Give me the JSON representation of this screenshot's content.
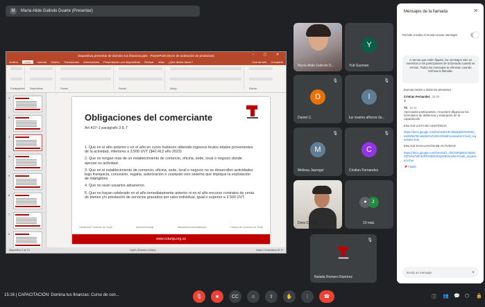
{
  "presenter_bar": {
    "initial": "M",
    "label": "María Alide Galindo Duarte (Presentar)"
  },
  "ppt": {
    "title": "Diapositiva presentar de dominio tus finanzas.pptx - PowerPoint (Error de activación de productos)",
    "tabs": [
      "Archivo",
      "Inicio",
      "Insertar",
      "Diseño",
      "Transiciones",
      "Animaciones",
      "Presentación con diapositivas",
      "Revisar",
      "Vista",
      "¿Qué desea hacer?"
    ],
    "user": "Cuenta web",
    "share": "Compartir",
    "ribbon_groups": [
      "Portapapeles",
      "Diapositivas",
      "Fuente",
      "Párrafo",
      "Dibujo",
      "Edición"
    ],
    "thumb_numbers": [
      "1",
      "2",
      "3",
      "4",
      "5",
      "6",
      "7",
      "8"
    ],
    "status_left": "Diapositiva 3 de 24",
    "status_lang": "Inglés (Estados Unidos)",
    "status_right": "Notas   Comentarios   81 %"
  },
  "slide": {
    "title": "Obligaciones del comerciante",
    "subtitle": "Art 437-1 parágrafo 3 E.T",
    "points": [
      "1. Que en el año anterior o en el año en curso hubieren obtenido ingresos brutos totales provenientes de la actividad, inferiores a 3.500 UVT ($42.412 año 2023)",
      "2. Que no tengan más de un establecimiento de comercio, oficina, sede, local o negocio donde ejerzan su actividad.",
      "3. Que en el establecimiento de comercio, oficina, sede, local o negocio no se desarrollen actividades bajo franquicia, concesión, regalía, autorización o cualquier otro sistema que implique la explotación de intangibles.",
      "4. Que no sean usuarios aduaneros.",
      "5. Que no hayan celebrado en el año inmediatamente anterior ni en el año encurso contratos de venta de bienes y/o prestación de servicios gravados por valor individual, igual o superior a 3.500 UVT."
    ],
    "footer": [
      "Cámara de Comercio de Tunja",
      "@comerciotunja",
      "camaradecomerciodetunja",
      "Cámara de Comercio de Tunja"
    ],
    "website": "www.cctunja.org.co"
  },
  "participants": [
    {
      "name": "María Alide Galindo D...",
      "kind": "video"
    },
    {
      "name": "Yuli Guzman",
      "initial": "Y",
      "color": "#0b5e48"
    },
    {
      "name": "Daniel C.",
      "initial": "D",
      "color": "#e8710a"
    },
    {
      "name": "luz marina alfonso du...",
      "initial": "l",
      "color": "#5f7d95"
    },
    {
      "name": "Melissa Jauregui",
      "initial": "M",
      "color": "#5f7d95"
    },
    {
      "name": "Cristian Fernandez",
      "initial": "C",
      "color": "#9334e6"
    },
    {
      "name": "Dora Carrillo",
      "kind": "video"
    },
    {
      "name": "10 más",
      "initial": "J",
      "color": "#1e8e3e"
    },
    {
      "name": "Natalia Romero Ramírez",
      "kind": "logo"
    }
  ],
  "panel": {
    "title": "Mensajes de la llamada",
    "permission": "Permitir a todos el mundo enviar mensajes",
    "info": "A menos que estén fijados, los mensajes solo se muestran a los participantes de la llamada cuando se envían. Todos los mensajes se eliminan cuando termina la llamada.",
    "prev": "Buenas tardes a todos los presentes",
    "msg1_sender": "Cristian Fernandez",
    "msg1_time": "15:09",
    "msg1_text": "si",
    "msg2_sender": "Tú",
    "msg2_time": "15:14",
    "msg2_text": "Apreciados participantes, recuerden diligenciar los formularios de asistencia y evaluación de la capacitación:",
    "att_title": "ENLACE LISTA DE ASISTENCIA",
    "att_link": "https://docs.google.com/forms/d/1iN-d5a9pbdnOWWN_ex8WheF8mu6dmOcZ1SXrJ2NvbhLvviewform?edit_requested=true",
    "eval_title": "ENLACE EVALUACIÓN DE ACTIVIDAD",
    "eval_link": "https://docs.google.com/forms/d/1_OE7stPqDtoG-5D6VSZPuhs7WP4nRPD3kOXEQsX8/viewform?edit_requested=true",
    "pin": "Fijado",
    "input_placeholder": "Envía un mensaje"
  },
  "bottom": {
    "clock": "15:16",
    "meeting": "CAPACITACIÓN: Domina tus finanzas: Curso de con..."
  }
}
